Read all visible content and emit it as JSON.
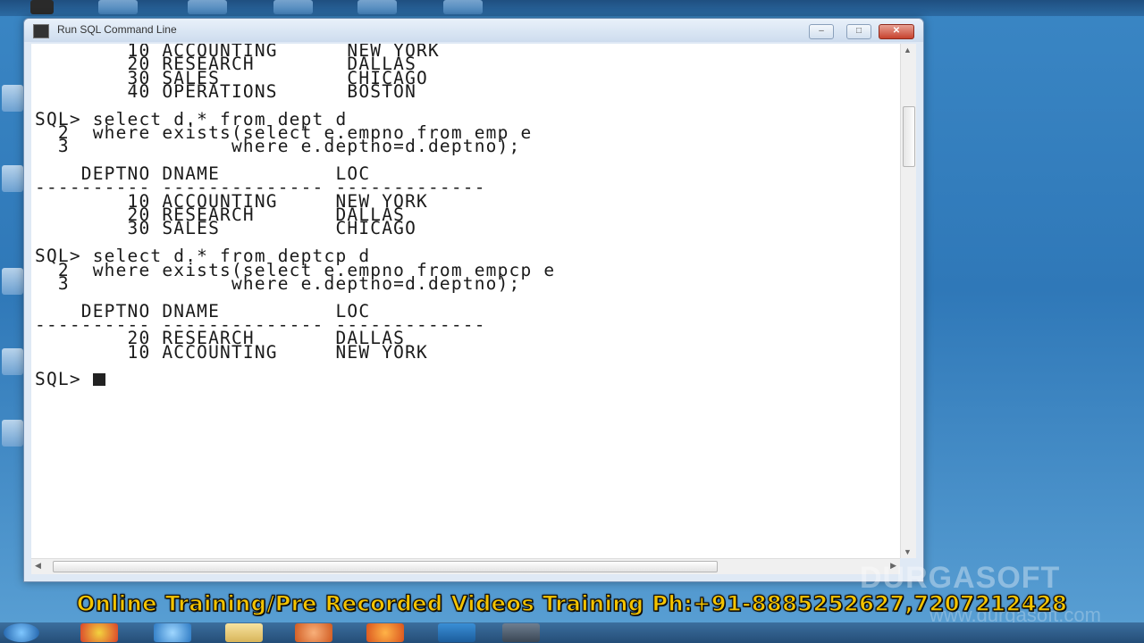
{
  "window": {
    "title": "Run SQL Command Line",
    "buttons": {
      "minimize": "–",
      "maximize": "□",
      "close": "✕"
    }
  },
  "console": {
    "lines": [
      "        10 ACCOUNTING      NEW YORK",
      "        20 RESEARCH        DALLAS",
      "        30 SALES           CHICAGO",
      "        40 OPERATIONS      BOSTON",
      "",
      "SQL> select d.* from dept d",
      "  2  where exists(select e.empno from emp e",
      "  3              where e.deptno=d.deptno);",
      "",
      "    DEPTNO DNAME          LOC",
      "---------- -------------- -------------",
      "        10 ACCOUNTING     NEW YORK",
      "        20 RESEARCH       DALLAS",
      "        30 SALES          CHICAGO",
      "",
      "SQL> select d.* from deptcp d",
      "  2  where exists(select e.empno from empcp e",
      "  3              where e.deptno=d.deptno);",
      "",
      "    DEPTNO DNAME          LOC",
      "---------- -------------- -------------",
      "        20 RESEARCH       DALLAS",
      "        10 ACCOUNTING     NEW YORK",
      ""
    ],
    "prompt": "SQL> "
  },
  "overlay": {
    "banner": "Online Training/Pre Recorded Videos Training Ph:+91-8885252627,7207212428",
    "watermark": "DURGASOFT",
    "watermark_url": "www.durgasoft.com"
  },
  "colors": {
    "banner_text": "#f4c400",
    "console_bg": "#ffffff",
    "console_text": "#1a1a1a"
  }
}
